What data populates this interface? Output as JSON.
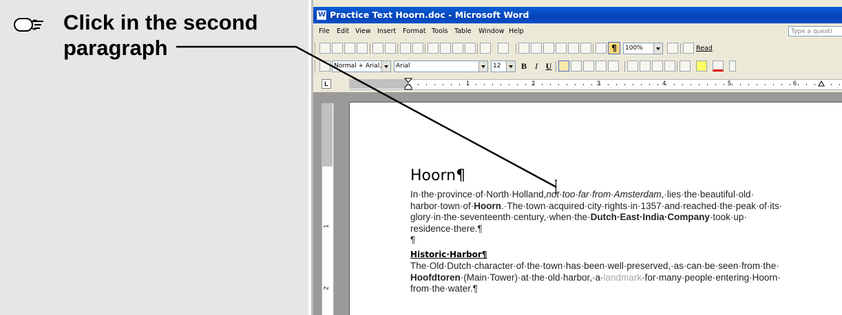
{
  "instruction": {
    "line1": "Click in the second",
    "line2": "paragraph"
  },
  "window": {
    "title": "Practice Text Hoorn.doc - Microsoft Word"
  },
  "menu": {
    "items": [
      "File",
      "Edit",
      "View",
      "Insert",
      "Format",
      "Tools",
      "Table",
      "Window",
      "Help"
    ],
    "ask_placeholder": "Type a questi"
  },
  "toolbar": {
    "zoom": "100%",
    "read_label": "Read",
    "style": "Normal + Arial,",
    "font": "Arial",
    "size": "12",
    "bold": "B",
    "italic": "I",
    "underline": "U",
    "pilcrow": "¶"
  },
  "ruler": {
    "numbers": [
      "1",
      "2",
      "3",
      "4",
      "5",
      "6"
    ],
    "vertical_numbers": [
      "1",
      "2"
    ],
    "tab_marker": "L"
  },
  "document": {
    "heading": "Hoorn¶",
    "p1_l1_a": "In·the·province·of·North·Holland,",
    "p1_l1_b": "not·too·far·from·Amsterdam",
    "p1_l1_c": ",·lies·the·beautiful·old·",
    "p1_l2_a": "harbor·town·of·",
    "p1_l2_b": "Hoorn",
    "p1_l2_c": ".·The·town·acquired·city·rights·in·1357·and·reached·the·peak·of·its·",
    "p1_l3_a": "glory·in·the·seventeenth·century,·when·the·",
    "p1_l3_b": "Dutch·East·India·Company",
    "p1_l3_c": "·took·up·",
    "p1_l4": "residence·there.¶",
    "empty_para": "¶",
    "subheading": "Historic·Harbor¶",
    "p2_l1": "The·Old·Dutch·character·of·the·town·has·been·well·preserved,·as·can·be·seen·from·the·",
    "p2_l2_a": "Hoofdtoren",
    "p2_l2_b": "·(Main·Tower)·at·the·old·harbor,·a·",
    "p2_l2_c": "landmark",
    "p2_l2_d": "·for·many·people·entering·Hoorn·",
    "p2_l3": "from·the·water.¶"
  },
  "colors": {
    "titlebar": "#0643b8",
    "panel": "#e6e6e6",
    "chrome": "#ece9d8"
  }
}
